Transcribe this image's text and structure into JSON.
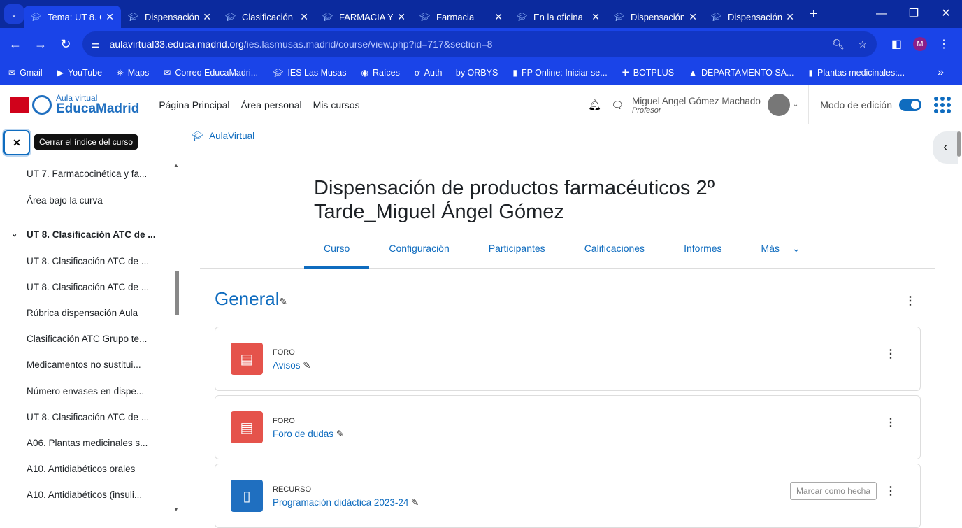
{
  "browser": {
    "tabs": [
      {
        "title": "Tema: UT 8. C",
        "active": true
      },
      {
        "title": "Dispensación"
      },
      {
        "title": "Clasificación"
      },
      {
        "title": "FARMACIA Y"
      },
      {
        "title": "Farmacia"
      },
      {
        "title": "En la oficina"
      },
      {
        "title": "Dispensación"
      },
      {
        "title": "Dispensación"
      }
    ],
    "url_host": "aulavirtual33.educa.madrid.org",
    "url_path": "/ies.lasmusas.madrid/course/view.php?id=717&section=8",
    "profile_initial": "M",
    "bookmarks": [
      "Gmail",
      "YouTube",
      "Maps",
      "Correo EducaMadri...",
      "IES Las Musas",
      "Raíces",
      "Auth — by ORBYS",
      "FP Online: Iniciar se...",
      "BOTPLUS",
      "DEPARTAMENTO SA...",
      "Plantas medicinales:..."
    ]
  },
  "header": {
    "logo_top": "Aula virtual",
    "logo_bottom": "EducaMadrid",
    "nav": [
      "Página Principal",
      "Área personal",
      "Mis cursos"
    ],
    "user_name": "Miguel Angel Gómez Machado",
    "user_role": "Profesor",
    "edit_mode": "Modo de edición",
    "edit_mode_on": true
  },
  "drawer": {
    "close_tooltip": "Cerrar el índice del curso",
    "items": [
      {
        "label": "UT 7. Farmacocinética y fa..."
      },
      {
        "label": "Área bajo la curva"
      },
      {
        "label": "UT 8. Clasificación ATC de ...",
        "section": true
      },
      {
        "label": "UT 8. Clasificación ATC de ..."
      },
      {
        "label": "UT 8. Clasificación ATC de ..."
      },
      {
        "label": "Rúbrica dispensación Aula"
      },
      {
        "label": "Clasificación ATC Grupo te..."
      },
      {
        "label": "Medicamentos no sustitui..."
      },
      {
        "label": "Número envases en dispe..."
      },
      {
        "label": "UT 8. Clasificación ATC de ..."
      },
      {
        "label": "A06. Plantas medicinales s..."
      },
      {
        "label": "A10. Antidiabéticos orales"
      },
      {
        "label": "A10. Antidiabéticos (insuli..."
      }
    ]
  },
  "main": {
    "breadcrumb": "AulaVirtual",
    "title": "Dispensación de productos farmacéuticos 2º Tarde_Miguel Ángel Gómez",
    "tabs": [
      "Curso",
      "Configuración",
      "Participantes",
      "Calificaciones",
      "Informes",
      "Más"
    ],
    "section": "General",
    "activities": [
      {
        "type": "FORO",
        "name": "Avisos",
        "color": "#e5534b"
      },
      {
        "type": "FORO",
        "name": "Foro de dudas",
        "color": "#e5534b"
      },
      {
        "type": "RECURSO",
        "name": "Programación didáctica 2023-24",
        "color": "#1f6fc0",
        "mark": "Marcar como hecha"
      }
    ]
  }
}
